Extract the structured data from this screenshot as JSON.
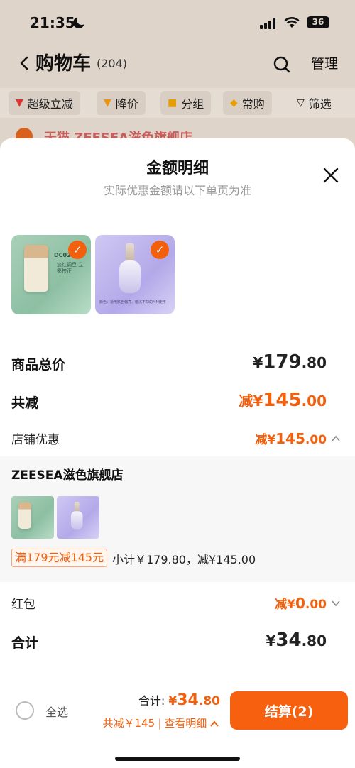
{
  "status_bar": {
    "time": "21:35",
    "battery": "36"
  },
  "cart_header": {
    "title": "购物车",
    "count": "(204)",
    "manage": "管理"
  },
  "filter_chips": [
    {
      "label": "超级立减",
      "icon": "red-down-arrow-icon"
    },
    {
      "label": "降价",
      "icon": "orange-down-arrow-icon"
    },
    {
      "label": "分组",
      "icon": "folder-icon"
    },
    {
      "label": "常购",
      "icon": "cart-icon"
    },
    {
      "label": "筛选",
      "icon": "filter-icon"
    }
  ],
  "store_peek": "天猫 ZEESEA滋色旗舰店",
  "sheet": {
    "title": "金额明细",
    "subtitle": "实际优惠金额请以下单页为准",
    "product_a_text": "DC02",
    "product_a_caption": "淡红调旦 立影校正",
    "product_b_caption": "颜色：适用肤色偏亮、暗沉不匀的MM使用",
    "total_price": {
      "label": "商品总价",
      "prefix": "¥",
      "int": "179",
      "dec": ".80"
    },
    "total_discount": {
      "label": "共减",
      "prefix": "减¥",
      "int": "145",
      "dec": ".00"
    },
    "store_discount": {
      "label": "店铺优惠",
      "prefix": "减¥",
      "int": "145",
      "dec": ".00"
    },
    "store": {
      "name": "ZEESEA滋色旗舰店",
      "coupon": "满179元减145元",
      "subtotal": "小计￥179.80，减¥145.00"
    },
    "red_packet": {
      "label": "红包",
      "prefix": "减¥",
      "int": "0",
      "dec": ".00"
    },
    "grand_total": {
      "label": "合计",
      "prefix": "¥",
      "int": "34",
      "dec": ".80"
    }
  },
  "bottom_bar": {
    "select_all": "全选",
    "total_label": "合计: ",
    "total_prefix": "¥",
    "total_int": "34",
    "total_dec": ".80",
    "discount": "共减￥145",
    "detail_link": "查看明细",
    "checkout": "结算(2)"
  },
  "colors": {
    "accent": "#f2600e",
    "text": "#111111",
    "muted": "#999999"
  }
}
